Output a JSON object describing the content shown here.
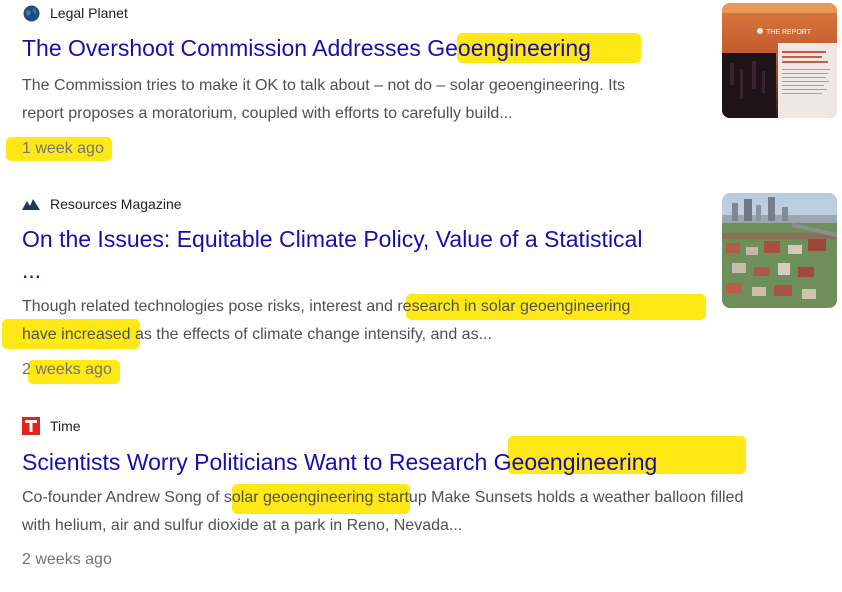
{
  "results": [
    {
      "source": "Legal Planet",
      "source_icon": "globe-icon",
      "title": "The Overshoot Commission Addresses Geoengineering",
      "snippet_line1": "The Commission tries to make it OK to talk about – not do – solar geoengineering. Its",
      "snippet_line2": "report proposes a moratorium, coupled with efforts to carefully build...",
      "age": "1 week ago",
      "thumb_caption": "THE REPORT",
      "thumb_subtext": "Reducing the Risks of Climate Overshoot"
    },
    {
      "source": "Resources Magazine",
      "source_icon": "mountain-logo-icon",
      "title_line1": "On the Issues: Equitable Climate Policy, Value of a Statistical",
      "title_line2": "...",
      "snippet_line1": "Though related technologies pose risks, interest and research in solar geoengineering",
      "snippet_line2": "have increased as the effects of climate change intensify, and as...",
      "age": "2 weeks ago"
    },
    {
      "source": "Time",
      "source_icon": "time-t-icon",
      "title": "Scientists Worry Politicians Want to Research Geoengineering",
      "snippet_line1": "Co-founder Andrew Song of solar geoengineering startup Make Sunsets holds a weather balloon filled",
      "snippet_line2": "with helium, air and sulfur dioxide at a park in Reno, Nevada...",
      "age": "2 weeks ago"
    }
  ],
  "colors": {
    "link": "#1a0dab",
    "snippet": "#4d5156",
    "age": "#70757a",
    "highlight": "#ffe600",
    "time_brand": "#e0231b"
  }
}
